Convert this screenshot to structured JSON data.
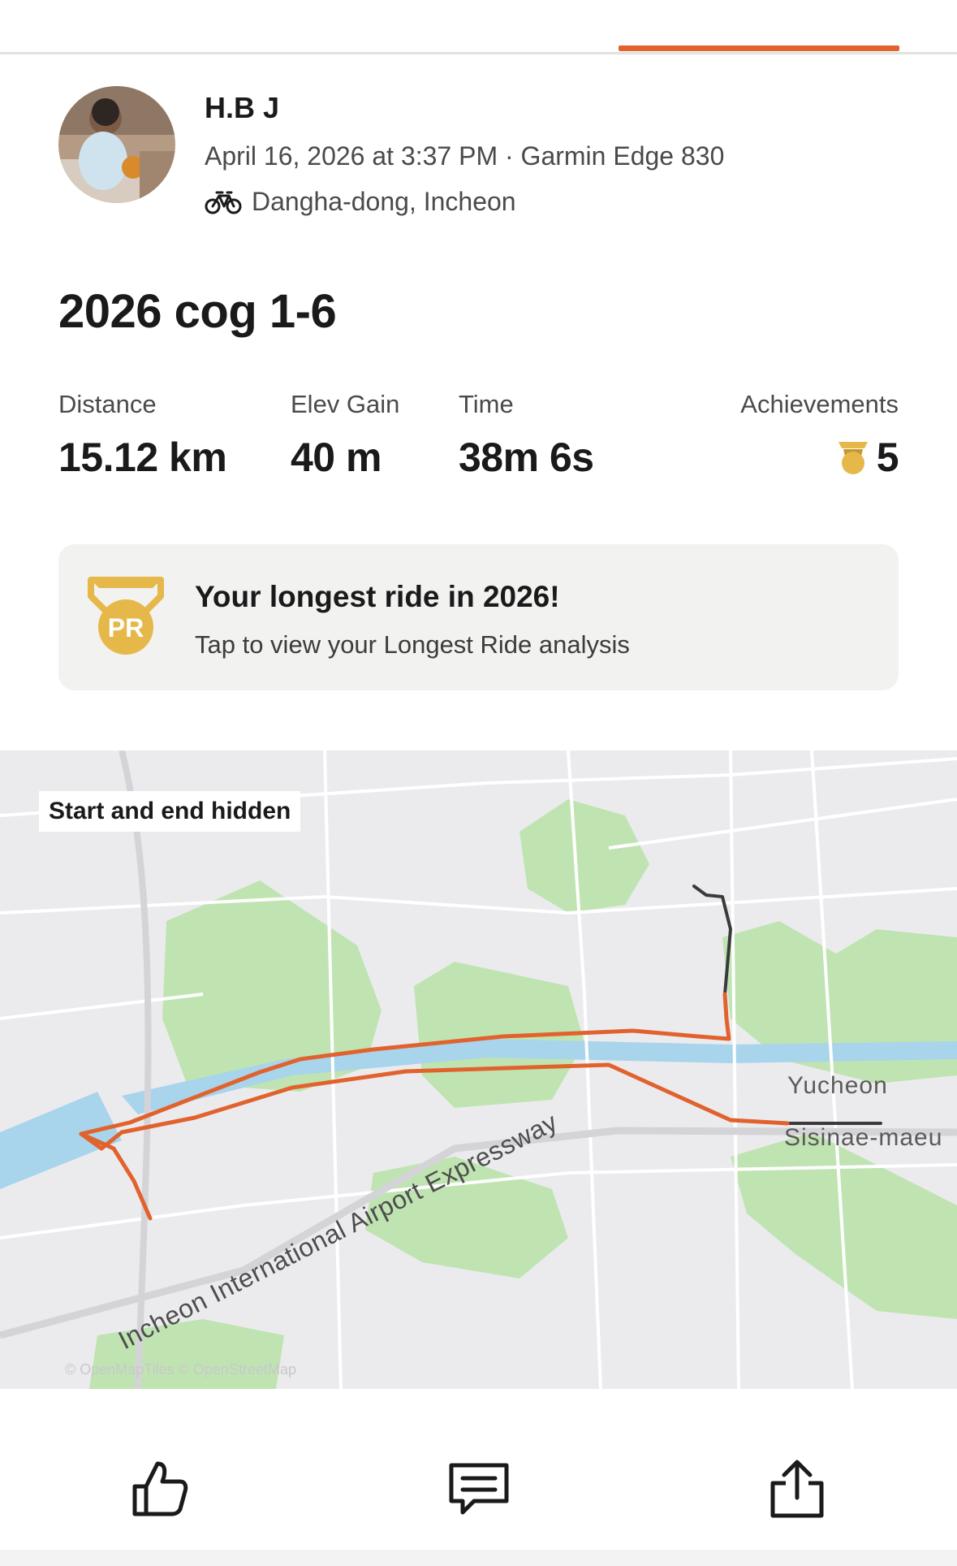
{
  "colors": {
    "accent": "#e2622d",
    "gold": "#e6b84a",
    "card": "#f2f2f0"
  },
  "athlete": {
    "name": "H.B J",
    "meta": "April 16, 2026 at 3:37 PM · Garmin Edge 830",
    "location": "Dangha-dong, Incheon",
    "sport_icon": "bike-icon"
  },
  "activity": {
    "title": "2026 cog 1-6"
  },
  "stats": [
    {
      "label": "Distance",
      "value": "15.12 km"
    },
    {
      "label": "Elev Gain",
      "value": "40 m"
    },
    {
      "label": "Time",
      "value": "38m 6s"
    }
  ],
  "achievements": {
    "label": "Achievements",
    "value": "5",
    "icon": "trophy-icon"
  },
  "pr_card": {
    "headline": "Your longest ride in 2026!",
    "subtext": "Tap to view your Longest Ride analysis",
    "badge_text": "PR"
  },
  "map": {
    "privacy_tag": "Start and end hidden",
    "labels": [
      "Yucheon",
      "Sisinae-maeu",
      "Incheon International Airport Expressway"
    ],
    "credit": "© OpenMapTiles © OpenStreetMap"
  },
  "actions": [
    "thumbs-up-icon",
    "comment-icon",
    "share-icon"
  ]
}
